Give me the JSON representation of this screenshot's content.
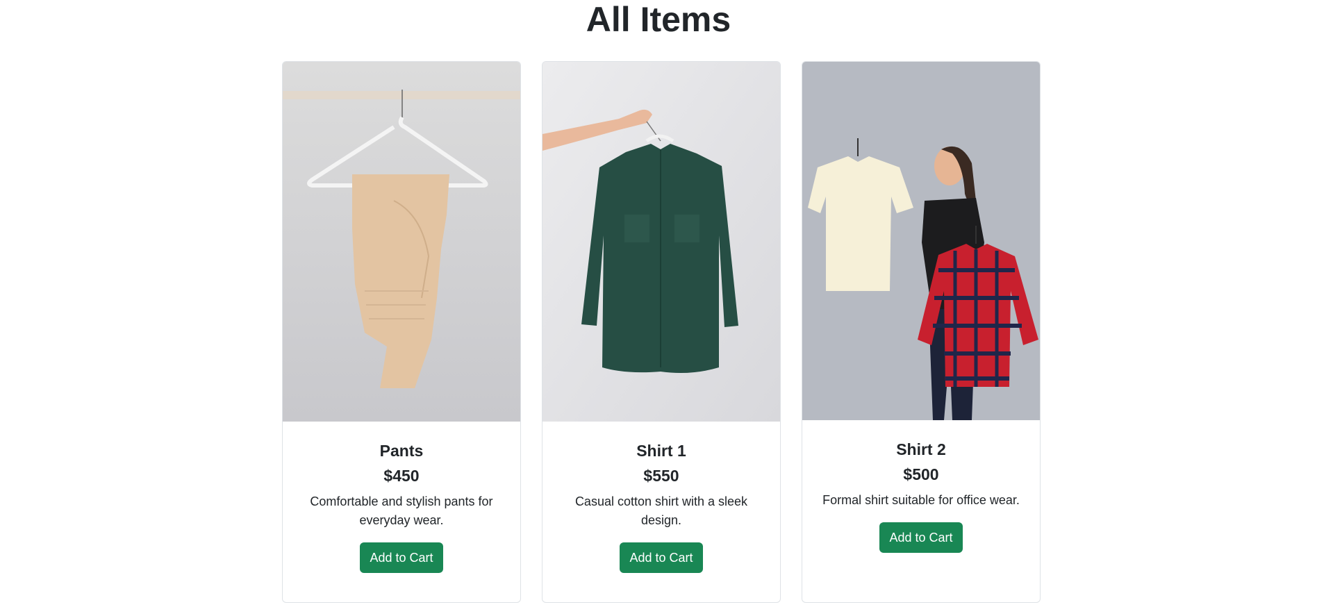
{
  "page": {
    "title": "All Items"
  },
  "products": [
    {
      "name": "Pants",
      "price": "$450",
      "description": "Comfortable and stylish pants for everyday wear.",
      "button_label": "Add to Cart"
    },
    {
      "name": "Shirt 1",
      "price": "$550",
      "description": "Casual cotton shirt with a sleek design.",
      "button_label": "Add to Cart"
    },
    {
      "name": "Shirt 2",
      "price": "$500",
      "description": "Formal shirt suitable for office wear.",
      "button_label": "Add to Cart"
    }
  ],
  "colors": {
    "button": "#198754",
    "text": "#212529",
    "card_border": "#dee2e6"
  }
}
